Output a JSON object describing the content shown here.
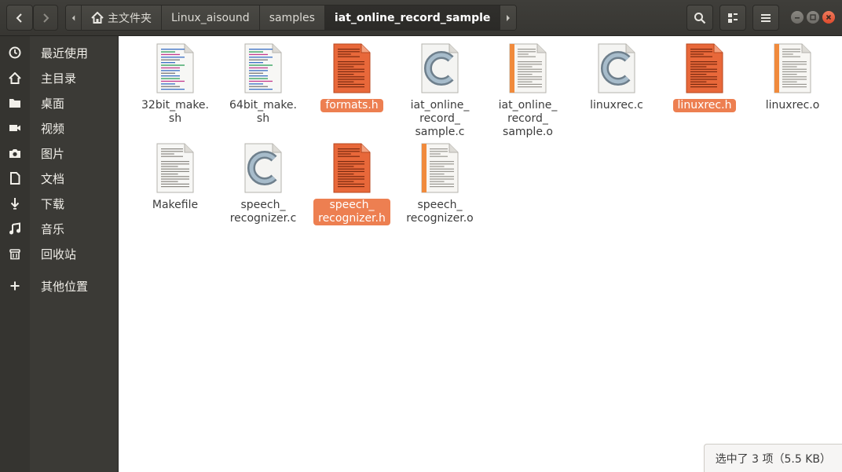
{
  "header": {
    "path": [
      {
        "label": "主文件夹",
        "home": true
      },
      {
        "label": "Linux_aisound"
      },
      {
        "label": "samples"
      },
      {
        "label": "iat_online_record_sample",
        "active": true
      }
    ]
  },
  "sidebar": {
    "items": [
      {
        "label": "最近使用",
        "icon": "clock-icon"
      },
      {
        "label": "主目录",
        "icon": "home-icon"
      },
      {
        "label": "桌面",
        "icon": "folder-icon"
      },
      {
        "label": "视频",
        "icon": "video-icon"
      },
      {
        "label": "图片",
        "icon": "camera-icon"
      },
      {
        "label": "文档",
        "icon": "document-icon"
      },
      {
        "label": "下载",
        "icon": "download-icon"
      },
      {
        "label": "音乐",
        "icon": "music-icon"
      },
      {
        "label": "回收站",
        "icon": "trash-icon"
      },
      {
        "label": "其他位置",
        "icon": "plus-icon"
      }
    ]
  },
  "files": [
    {
      "name": "32bit_make.\nsh",
      "type": "script",
      "selected": false
    },
    {
      "name": "64bit_make.\nsh",
      "type": "script",
      "selected": false
    },
    {
      "name": "formats.h",
      "type": "header",
      "selected": true
    },
    {
      "name": "iat_online_\nrecord_\nsample.c",
      "type": "c-source",
      "selected": false
    },
    {
      "name": "iat_online_\nrecord_\nsample.o",
      "type": "object",
      "selected": false
    },
    {
      "name": "linuxrec.c",
      "type": "c-source",
      "selected": false
    },
    {
      "name": "linuxrec.h",
      "type": "header",
      "selected": true
    },
    {
      "name": "linuxrec.o",
      "type": "object",
      "selected": false
    },
    {
      "name": "Makefile",
      "type": "text",
      "selected": false
    },
    {
      "name": "speech_\nrecognizer.c",
      "type": "c-source",
      "selected": false
    },
    {
      "name": "speech_\nrecognizer.h",
      "type": "header",
      "selected": true
    },
    {
      "name": "speech_\nrecognizer.o",
      "type": "object",
      "selected": false
    }
  ],
  "status": {
    "text": "选中了 3 项（5.5 KB）"
  },
  "colors": {
    "accent": "#ed7f51",
    "header_bg": "#3c3b37",
    "sidebar_bg": "#3b3a36",
    "close": "#e9573f"
  }
}
